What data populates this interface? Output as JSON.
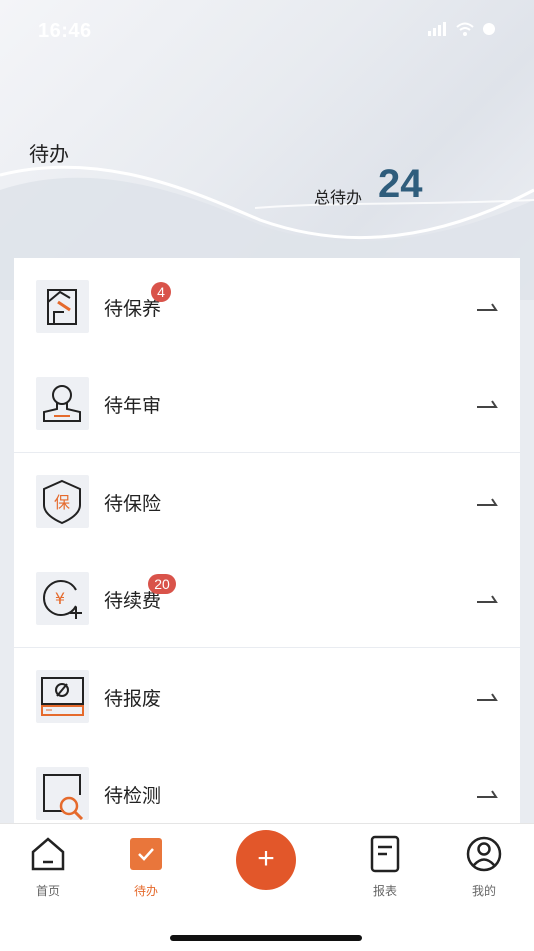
{
  "status_bar": {
    "time": "16:46"
  },
  "header": {
    "title": "待办",
    "total_label": "总待办",
    "total_count": "24"
  },
  "colors": {
    "accent": "#e2572a",
    "count": "#2f5d7c",
    "badge": "#d9534a"
  },
  "tasks": [
    {
      "label": "待保养",
      "icon": "maintenance-icon",
      "badge": "4"
    },
    {
      "label": "待年审",
      "icon": "annual-review-icon",
      "badge": ""
    },
    {
      "label": "待保险",
      "icon": "insurance-shield-icon",
      "badge": "",
      "icon_text": "保"
    },
    {
      "label": "待续费",
      "icon": "renewal-fee-icon",
      "badge": "20",
      "icon_text": "¥"
    },
    {
      "label": "待报废",
      "icon": "scrap-icon",
      "badge": ""
    },
    {
      "label": "待检测",
      "icon": "inspection-icon",
      "badge": ""
    }
  ],
  "tabbar": {
    "home": "首页",
    "todo": "待办",
    "add": "+",
    "report": "报表",
    "mine": "我的"
  }
}
